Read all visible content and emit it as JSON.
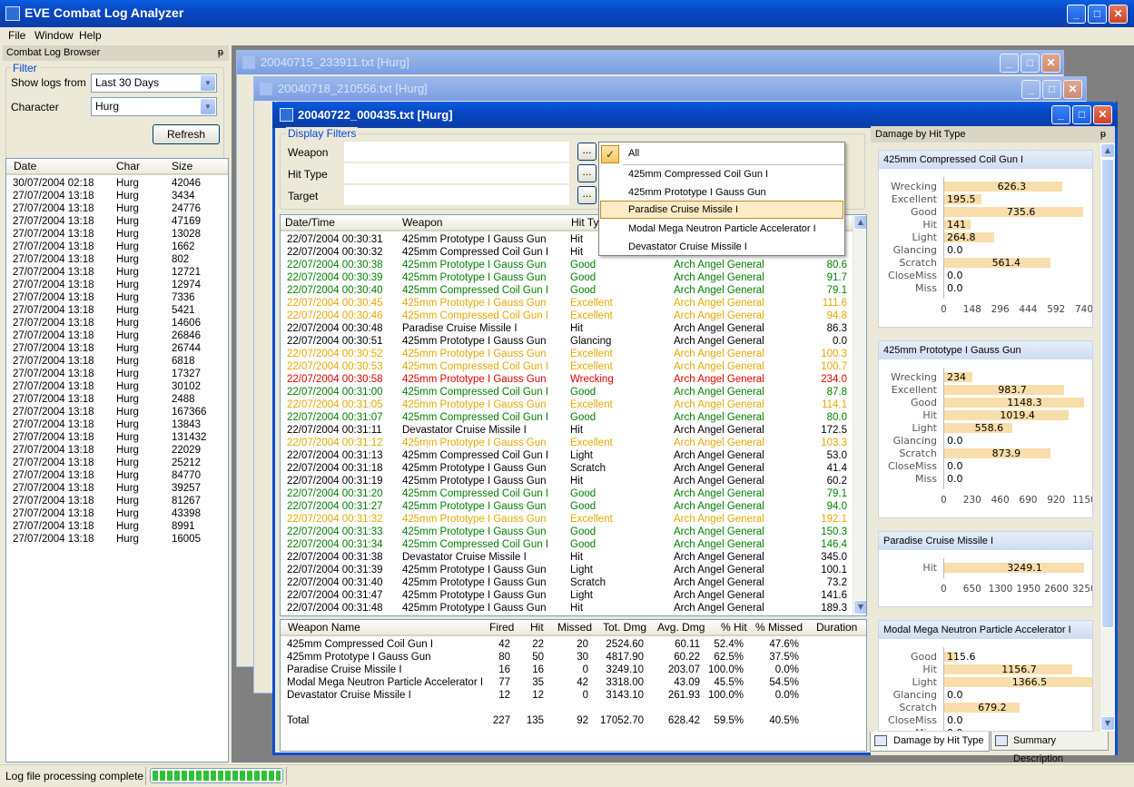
{
  "app": {
    "title": "EVE Combat Log Analyzer"
  },
  "menu": [
    "File",
    "Window",
    "Help"
  ],
  "browser": {
    "title": "Combat Log Browser",
    "filter_label": "Filter",
    "show_logs_label": "Show logs from",
    "show_logs_value": "Last 30 Days",
    "character_label": "Character",
    "character_value": "Hurg",
    "refresh": "Refresh",
    "columns": [
      "Date",
      "Char",
      "Size"
    ],
    "rows": [
      [
        "30/07/2004 02:18",
        "Hurg",
        "42046"
      ],
      [
        "27/07/2004 13:18",
        "Hurg",
        "3434"
      ],
      [
        "27/07/2004 13:18",
        "Hurg",
        "24776"
      ],
      [
        "27/07/2004 13:18",
        "Hurg",
        "47169"
      ],
      [
        "27/07/2004 13:18",
        "Hurg",
        "13028"
      ],
      [
        "27/07/2004 13:18",
        "Hurg",
        "1662"
      ],
      [
        "27/07/2004 13:18",
        "Hurg",
        "802"
      ],
      [
        "27/07/2004 13:18",
        "Hurg",
        "12721"
      ],
      [
        "27/07/2004 13:18",
        "Hurg",
        "12974"
      ],
      [
        "27/07/2004 13:18",
        "Hurg",
        "7336"
      ],
      [
        "27/07/2004 13:18",
        "Hurg",
        "5421"
      ],
      [
        "27/07/2004 13:18",
        "Hurg",
        "14606"
      ],
      [
        "27/07/2004 13:18",
        "Hurg",
        "26846"
      ],
      [
        "27/07/2004 13:18",
        "Hurg",
        "26744"
      ],
      [
        "27/07/2004 13:18",
        "Hurg",
        "6818"
      ],
      [
        "27/07/2004 13:18",
        "Hurg",
        "17327"
      ],
      [
        "27/07/2004 13:18",
        "Hurg",
        "30102"
      ],
      [
        "27/07/2004 13:18",
        "Hurg",
        "2488"
      ],
      [
        "27/07/2004 13:18",
        "Hurg",
        "167366"
      ],
      [
        "27/07/2004 13:18",
        "Hurg",
        "13843"
      ],
      [
        "27/07/2004 13:18",
        "Hurg",
        "131432"
      ],
      [
        "27/07/2004 13:18",
        "Hurg",
        "22029"
      ],
      [
        "27/07/2004 13:18",
        "Hurg",
        "25212"
      ],
      [
        "27/07/2004 13:18",
        "Hurg",
        "84770"
      ],
      [
        "27/07/2004 13:18",
        "Hurg",
        "39257"
      ],
      [
        "27/07/2004 13:18",
        "Hurg",
        "81267"
      ],
      [
        "27/07/2004 13:18",
        "Hurg",
        "43398"
      ],
      [
        "27/07/2004 13:18",
        "Hurg",
        "8991"
      ],
      [
        "27/07/2004 13:18",
        "Hurg",
        "16005"
      ]
    ]
  },
  "bg_windows": [
    "20040715_233911.txt [Hurg]",
    "20040718_210556.txt [Hurg]"
  ],
  "log_window": {
    "title": "20040722_000435.txt [Hurg]",
    "display_filters": "Display Filters",
    "weapon_label": "Weapon",
    "hittype_label": "Hit Type",
    "target_label": "Target",
    "ellipsis": "...",
    "columns": [
      "Date/Time",
      "Weapon",
      "Hit Type"
    ],
    "rows": [
      [
        "22/07/2004 00:30:31",
        "425mm Prototype I Gauss Gun",
        "Hit",
        "",
        "",
        "black"
      ],
      [
        "22/07/2004 00:30:32",
        "425mm Compressed Coil Gun I",
        "Hit",
        "",
        "",
        "black"
      ],
      [
        "22/07/2004 00:30:38",
        "425mm Prototype I Gauss Gun",
        "Good",
        "Arch Angel General",
        "80.6",
        "green"
      ],
      [
        "22/07/2004 00:30:39",
        "425mm Prototype I Gauss Gun",
        "Good",
        "Arch Angel General",
        "91.7",
        "green"
      ],
      [
        "22/07/2004 00:30:40",
        "425mm Compressed Coil Gun I",
        "Good",
        "Arch Angel General",
        "79.1",
        "green"
      ],
      [
        "22/07/2004 00:30:45",
        "425mm Prototype I Gauss Gun",
        "Excellent",
        "Arch Angel General",
        "111.6",
        "orange"
      ],
      [
        "22/07/2004 00:30:46",
        "425mm Compressed Coil Gun I",
        "Excellent",
        "Arch Angel General",
        "94.8",
        "orange"
      ],
      [
        "22/07/2004 00:30:48",
        "Paradise Cruise Missile I",
        "Hit",
        "Arch Angel General",
        "86.3",
        "black"
      ],
      [
        "22/07/2004 00:30:51",
        "425mm Prototype I Gauss Gun",
        "Glancing",
        "Arch Angel General",
        "0.0",
        "black"
      ],
      [
        "22/07/2004 00:30:52",
        "425mm Prototype I Gauss Gun",
        "Excellent",
        "Arch Angel General",
        "100.3",
        "orange"
      ],
      [
        "22/07/2004 00:30:53",
        "425mm Compressed Coil Gun I",
        "Excellent",
        "Arch Angel General",
        "100.7",
        "orange"
      ],
      [
        "22/07/2004 00:30:58",
        "425mm Prototype I Gauss Gun",
        "Wrecking",
        "Arch Angel General",
        "234.0",
        "red"
      ],
      [
        "22/07/2004 00:31:00",
        "425mm Compressed Coil Gun I",
        "Good",
        "Arch Angel General",
        "87.8",
        "green"
      ],
      [
        "22/07/2004 00:31:05",
        "425mm Prototype I Gauss Gun",
        "Excellent",
        "Arch Angel General",
        "114.1",
        "orange"
      ],
      [
        "22/07/2004 00:31:07",
        "425mm Compressed Coil Gun I",
        "Good",
        "Arch Angel General",
        "80.0",
        "green"
      ],
      [
        "22/07/2004 00:31:11",
        "Devastator Cruise Missile I",
        "Hit",
        "Arch Angel General",
        "172.5",
        "black"
      ],
      [
        "22/07/2004 00:31:12",
        "425mm Prototype I Gauss Gun",
        "Excellent",
        "Arch Angel General",
        "103.3",
        "orange"
      ],
      [
        "22/07/2004 00:31:13",
        "425mm Compressed Coil Gun I",
        "Light",
        "Arch Angel General",
        "53.0",
        "black"
      ],
      [
        "22/07/2004 00:31:18",
        "425mm Prototype I Gauss Gun",
        "Scratch",
        "Arch Angel General",
        "41.4",
        "black"
      ],
      [
        "22/07/2004 00:31:19",
        "425mm Prototype I Gauss Gun",
        "Hit",
        "Arch Angel General",
        "60.2",
        "black"
      ],
      [
        "22/07/2004 00:31:20",
        "425mm Compressed Coil Gun I",
        "Good",
        "Arch Angel General",
        "79.1",
        "green"
      ],
      [
        "22/07/2004 00:31:27",
        "425mm Prototype I Gauss Gun",
        "Good",
        "Arch Angel General",
        "94.0",
        "green"
      ],
      [
        "22/07/2004 00:31:32",
        "425mm Prototype I Gauss Gun",
        "Excellent",
        "Arch Angel General",
        "192.1",
        "orange"
      ],
      [
        "22/07/2004 00:31:33",
        "425mm Prototype I Gauss Gun",
        "Good",
        "Arch Angel General",
        "150.3",
        "green"
      ],
      [
        "22/07/2004 00:31:34",
        "425mm Compressed Coil Gun I",
        "Good",
        "Arch Angel General",
        "146.4",
        "green"
      ],
      [
        "22/07/2004 00:31:38",
        "Devastator Cruise Missile I",
        "Hit",
        "Arch Angel General",
        "345.0",
        "black"
      ],
      [
        "22/07/2004 00:31:39",
        "425mm Prototype I Gauss Gun",
        "Light",
        "Arch Angel General",
        "100.1",
        "black"
      ],
      [
        "22/07/2004 00:31:40",
        "425mm Prototype I Gauss Gun",
        "Scratch",
        "Arch Angel General",
        "73.2",
        "black"
      ],
      [
        "22/07/2004 00:31:47",
        "425mm Prototype I Gauss Gun",
        "Light",
        "Arch Angel General",
        "141.6",
        "black"
      ],
      [
        "22/07/2004 00:31:48",
        "425mm Prototype I Gauss Gun",
        "Hit",
        "Arch Angel General",
        "189.3",
        "black"
      ]
    ],
    "dropdown": [
      "All",
      "425mm Compressed Coil Gun I",
      "425mm Prototype I Gauss Gun",
      "Paradise Cruise Missile I",
      "Modal Mega Neutron Particle Accelerator I",
      "Devastator Cruise Missile I"
    ],
    "summary_columns": [
      "Weapon Name",
      "Fired",
      "Hit",
      "Missed",
      "Tot. Dmg",
      "Avg. Dmg",
      "% Hit",
      "% Missed",
      "Duration"
    ],
    "summary_rows": [
      [
        "425mm Compressed Coil Gun I",
        "42",
        "22",
        "20",
        "2524.60",
        "60.11",
        "52.4%",
        "47.6%"
      ],
      [
        "425mm Prototype I Gauss Gun",
        "80",
        "50",
        "30",
        "4817.90",
        "60.22",
        "62.5%",
        "37.5%"
      ],
      [
        "Paradise Cruise Missile I",
        "16",
        "16",
        "0",
        "3249.10",
        "203.07",
        "100.0%",
        "0.0%"
      ],
      [
        "Modal Mega Neutron Particle Accelerator I",
        "77",
        "35",
        "42",
        "3318.00",
        "43.09",
        "45.5%",
        "54.5%"
      ],
      [
        "Devastator Cruise Missile I",
        "12",
        "12",
        "0",
        "3143.10",
        "261.93",
        "100.0%",
        "0.0%"
      ]
    ],
    "total_row": [
      "Total",
      "227",
      "135",
      "92",
      "17052.70",
      "628.42",
      "59.5%",
      "40.5%"
    ]
  },
  "damage_panel": {
    "title": "Damage by Hit Type",
    "tabs": [
      "Damage by Hit Type",
      "Summary Description"
    ]
  },
  "chart_data": [
    {
      "type": "bar",
      "title": "425mm Compressed Coil Gun I",
      "categories": [
        "Wrecking",
        "Excellent",
        "Good",
        "Hit",
        "Light",
        "Glancing",
        "Scratch",
        "CloseMiss",
        "Miss"
      ],
      "values": [
        626.3,
        195.5,
        735.6,
        141,
        264.8,
        0.0,
        561.4,
        0.0,
        0.0
      ],
      "xlim": [
        0,
        740
      ],
      "ticks": [
        "0",
        "148",
        "296",
        "444",
        "592",
        "740"
      ]
    },
    {
      "type": "bar",
      "title": "425mm Prototype I Gauss Gun",
      "categories": [
        "Wrecking",
        "Excellent",
        "Good",
        "Hit",
        "Light",
        "Glancing",
        "Scratch",
        "CloseMiss",
        "Miss"
      ],
      "values": [
        234,
        983.7,
        1148.3,
        1019.4,
        558.6,
        0.0,
        873.9,
        0.0,
        0.0
      ],
      "xlim": [
        0,
        1150
      ],
      "ticks": [
        "0",
        "230",
        "460",
        "690",
        "920",
        "1150"
      ]
    },
    {
      "type": "bar",
      "title": "Paradise Cruise Missile I",
      "categories": [
        "Hit"
      ],
      "values": [
        3249.1
      ],
      "xlim": [
        0,
        3250
      ],
      "ticks": [
        "0",
        "650",
        "1300",
        "1950",
        "2600",
        "3250"
      ]
    },
    {
      "type": "bar",
      "title": "Modal Mega Neutron Particle Accelerator I",
      "categories": [
        "Good",
        "Hit",
        "Light",
        "Glancing",
        "Scratch",
        "CloseMiss",
        "Miss"
      ],
      "values": [
        115.6,
        1156.7,
        1366.5,
        0.0,
        679.2,
        0.0,
        0.0
      ],
      "xlim": [
        0,
        1366.5
      ],
      "ticks": []
    }
  ],
  "status": {
    "text": "Log file processing complete",
    "progress": 1.0
  },
  "colors": {
    "green": "#008000",
    "orange": "#e6a800",
    "red": "#e00000",
    "bar": "#f8deaa",
    "titlebar": "#0a4fd1"
  }
}
